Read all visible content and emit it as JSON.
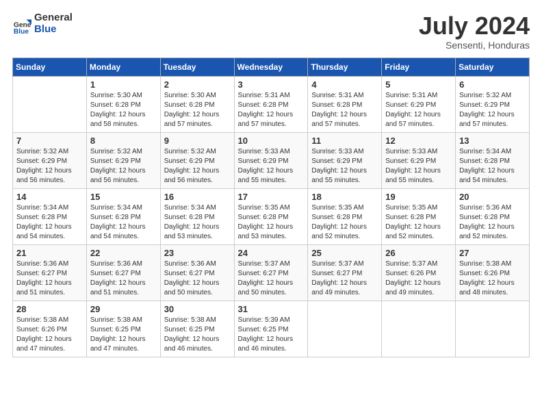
{
  "logo": {
    "general": "General",
    "blue": "Blue"
  },
  "title": "July 2024",
  "location": "Sensenti, Honduras",
  "days_header": [
    "Sunday",
    "Monday",
    "Tuesday",
    "Wednesday",
    "Thursday",
    "Friday",
    "Saturday"
  ],
  "weeks": [
    [
      {
        "num": "",
        "info": ""
      },
      {
        "num": "1",
        "info": "Sunrise: 5:30 AM\nSunset: 6:28 PM\nDaylight: 12 hours\nand 58 minutes."
      },
      {
        "num": "2",
        "info": "Sunrise: 5:30 AM\nSunset: 6:28 PM\nDaylight: 12 hours\nand 57 minutes."
      },
      {
        "num": "3",
        "info": "Sunrise: 5:31 AM\nSunset: 6:28 PM\nDaylight: 12 hours\nand 57 minutes."
      },
      {
        "num": "4",
        "info": "Sunrise: 5:31 AM\nSunset: 6:28 PM\nDaylight: 12 hours\nand 57 minutes."
      },
      {
        "num": "5",
        "info": "Sunrise: 5:31 AM\nSunset: 6:29 PM\nDaylight: 12 hours\nand 57 minutes."
      },
      {
        "num": "6",
        "info": "Sunrise: 5:32 AM\nSunset: 6:29 PM\nDaylight: 12 hours\nand 57 minutes."
      }
    ],
    [
      {
        "num": "7",
        "info": "Sunrise: 5:32 AM\nSunset: 6:29 PM\nDaylight: 12 hours\nand 56 minutes."
      },
      {
        "num": "8",
        "info": "Sunrise: 5:32 AM\nSunset: 6:29 PM\nDaylight: 12 hours\nand 56 minutes."
      },
      {
        "num": "9",
        "info": "Sunrise: 5:32 AM\nSunset: 6:29 PM\nDaylight: 12 hours\nand 56 minutes."
      },
      {
        "num": "10",
        "info": "Sunrise: 5:33 AM\nSunset: 6:29 PM\nDaylight: 12 hours\nand 55 minutes."
      },
      {
        "num": "11",
        "info": "Sunrise: 5:33 AM\nSunset: 6:29 PM\nDaylight: 12 hours\nand 55 minutes."
      },
      {
        "num": "12",
        "info": "Sunrise: 5:33 AM\nSunset: 6:29 PM\nDaylight: 12 hours\nand 55 minutes."
      },
      {
        "num": "13",
        "info": "Sunrise: 5:34 AM\nSunset: 6:28 PM\nDaylight: 12 hours\nand 54 minutes."
      }
    ],
    [
      {
        "num": "14",
        "info": "Sunrise: 5:34 AM\nSunset: 6:28 PM\nDaylight: 12 hours\nand 54 minutes."
      },
      {
        "num": "15",
        "info": "Sunrise: 5:34 AM\nSunset: 6:28 PM\nDaylight: 12 hours\nand 54 minutes."
      },
      {
        "num": "16",
        "info": "Sunrise: 5:34 AM\nSunset: 6:28 PM\nDaylight: 12 hours\nand 53 minutes."
      },
      {
        "num": "17",
        "info": "Sunrise: 5:35 AM\nSunset: 6:28 PM\nDaylight: 12 hours\nand 53 minutes."
      },
      {
        "num": "18",
        "info": "Sunrise: 5:35 AM\nSunset: 6:28 PM\nDaylight: 12 hours\nand 52 minutes."
      },
      {
        "num": "19",
        "info": "Sunrise: 5:35 AM\nSunset: 6:28 PM\nDaylight: 12 hours\nand 52 minutes."
      },
      {
        "num": "20",
        "info": "Sunrise: 5:36 AM\nSunset: 6:28 PM\nDaylight: 12 hours\nand 52 minutes."
      }
    ],
    [
      {
        "num": "21",
        "info": "Sunrise: 5:36 AM\nSunset: 6:27 PM\nDaylight: 12 hours\nand 51 minutes."
      },
      {
        "num": "22",
        "info": "Sunrise: 5:36 AM\nSunset: 6:27 PM\nDaylight: 12 hours\nand 51 minutes."
      },
      {
        "num": "23",
        "info": "Sunrise: 5:36 AM\nSunset: 6:27 PM\nDaylight: 12 hours\nand 50 minutes."
      },
      {
        "num": "24",
        "info": "Sunrise: 5:37 AM\nSunset: 6:27 PM\nDaylight: 12 hours\nand 50 minutes."
      },
      {
        "num": "25",
        "info": "Sunrise: 5:37 AM\nSunset: 6:27 PM\nDaylight: 12 hours\nand 49 minutes."
      },
      {
        "num": "26",
        "info": "Sunrise: 5:37 AM\nSunset: 6:26 PM\nDaylight: 12 hours\nand 49 minutes."
      },
      {
        "num": "27",
        "info": "Sunrise: 5:38 AM\nSunset: 6:26 PM\nDaylight: 12 hours\nand 48 minutes."
      }
    ],
    [
      {
        "num": "28",
        "info": "Sunrise: 5:38 AM\nSunset: 6:26 PM\nDaylight: 12 hours\nand 47 minutes."
      },
      {
        "num": "29",
        "info": "Sunrise: 5:38 AM\nSunset: 6:25 PM\nDaylight: 12 hours\nand 47 minutes."
      },
      {
        "num": "30",
        "info": "Sunrise: 5:38 AM\nSunset: 6:25 PM\nDaylight: 12 hours\nand 46 minutes."
      },
      {
        "num": "31",
        "info": "Sunrise: 5:39 AM\nSunset: 6:25 PM\nDaylight: 12 hours\nand 46 minutes."
      },
      {
        "num": "",
        "info": ""
      },
      {
        "num": "",
        "info": ""
      },
      {
        "num": "",
        "info": ""
      }
    ]
  ]
}
